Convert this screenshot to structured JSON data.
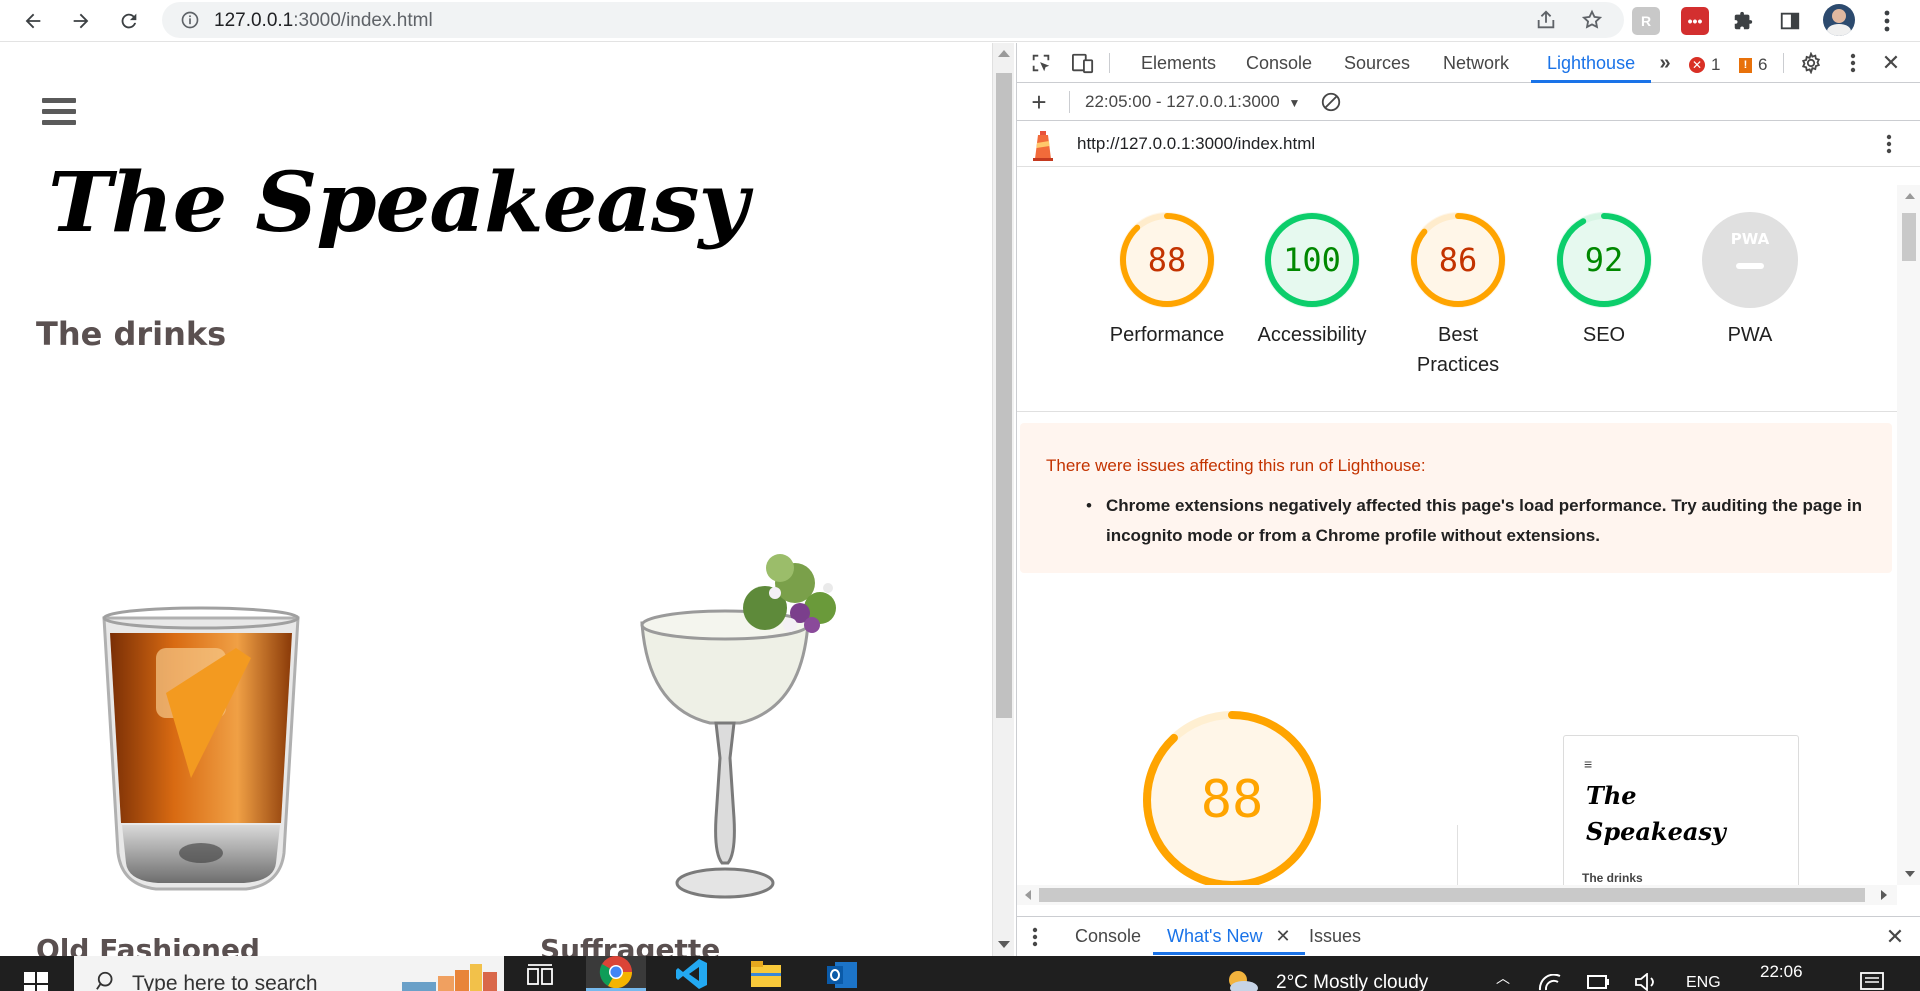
{
  "browser": {
    "url_host": "127.0.0.1",
    "url_rest": ":3000/index.html"
  },
  "page": {
    "site_title": "The Speakeasy",
    "section_heading": "The drinks",
    "drinks": [
      {
        "name": "Old Fashioned"
      },
      {
        "name": "Suffragette"
      }
    ]
  },
  "devtools": {
    "tabs": [
      "Elements",
      "Console",
      "Sources",
      "Network",
      "Lighthouse"
    ],
    "active_tab": "Lighthouse",
    "error_count": "1",
    "warning_count": "6",
    "report_selector": "22:05:00 - 127.0.0.1:3000",
    "report_url": "http://127.0.0.1:3000/index.html",
    "scores": [
      {
        "label": "Performance",
        "value": "88",
        "fraction": 0.88,
        "status": "average"
      },
      {
        "label": "Accessibility",
        "value": "100",
        "fraction": 1.0,
        "status": "pass"
      },
      {
        "label": "Best Practices",
        "value": "86",
        "fraction": 0.86,
        "status": "average"
      },
      {
        "label": "SEO",
        "value": "92",
        "fraction": 0.92,
        "status": "pass"
      },
      {
        "label": "PWA",
        "value": "PWA",
        "fraction": 0,
        "status": "na"
      }
    ],
    "warning": {
      "title": "There were issues affecting this run of Lighthouse:",
      "item": "Chrome extensions negatively affected this page's load performance. Try auditing the page in incognito mode or from a Chrome profile without extensions."
    },
    "performance_gauge": {
      "value": "88",
      "fraction": 0.88
    },
    "thumbnail": {
      "title_line1": "The",
      "title_line2": "Speakeasy",
      "heading": "The drinks"
    },
    "drawer_tabs": [
      "Console",
      "What's New",
      "Issues"
    ],
    "drawer_active": "What's New"
  },
  "taskbar": {
    "search_placeholder": "Type here to search",
    "weather": "2°C  Mostly cloudy",
    "language": "ENG",
    "time": "22:06"
  },
  "colors": {
    "pass": "#0cce6b",
    "pass_text": "#008800",
    "pass_bg": "#e6f9ef",
    "average": "#ffa400",
    "average_text": "#c33300",
    "average_bg": "#fff6e8",
    "na": "#e0e0e0",
    "accent": "#1a73e8"
  }
}
